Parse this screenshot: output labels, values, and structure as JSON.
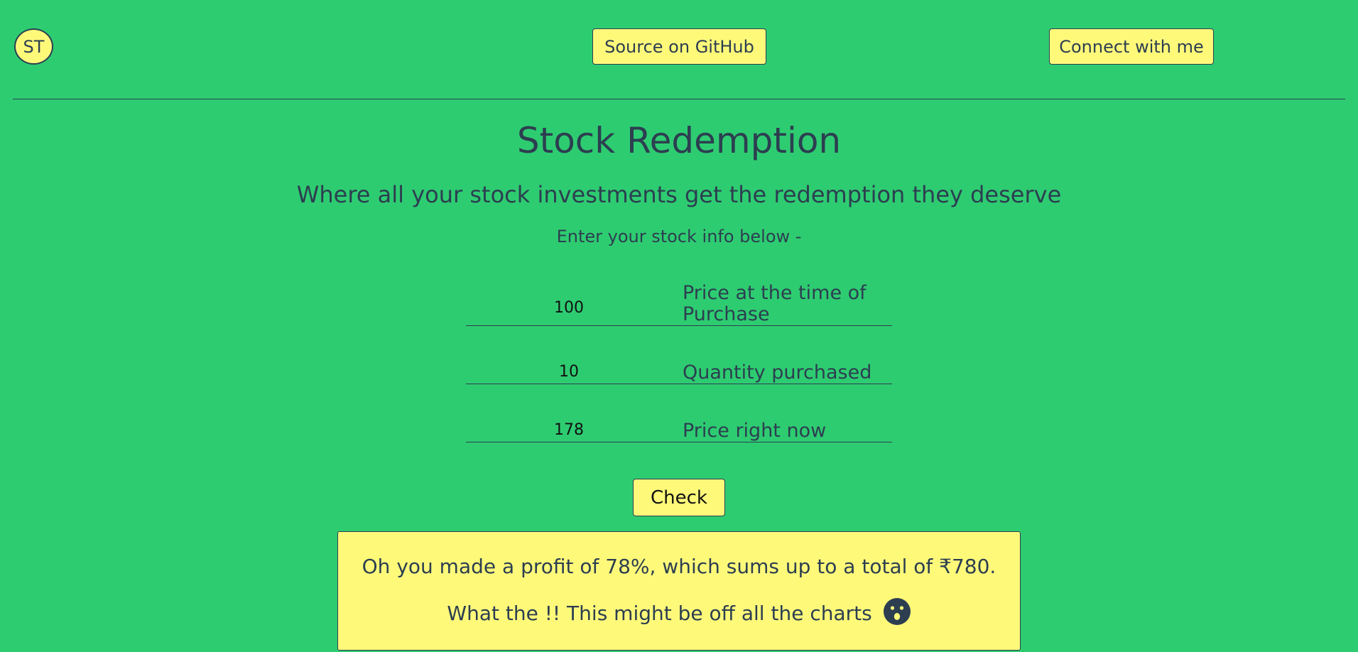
{
  "header": {
    "avatar_initials": "ST",
    "github_label": "Source on GitHub",
    "connect_label": "Connect with me"
  },
  "main": {
    "title": "Stock Redemption",
    "subtitle": "Where all your stock investments get the redemption they deserve",
    "prompt": "Enter your stock info below -"
  },
  "form": {
    "purchase_price": {
      "value": "100",
      "label": "Price at the time of Purchase"
    },
    "quantity": {
      "value": "10",
      "label": "Quantity purchased"
    },
    "current_price": {
      "value": "178",
      "label": "Price right now"
    },
    "check_label": "Check"
  },
  "output": {
    "message": "Oh you made a profit of 78%, which sums up to a total of ₹780.",
    "remark": "What the !! This might be off all the charts",
    "emoji_icon": "astonished-face-icon"
  },
  "colors": {
    "background": "#2ecc71",
    "accent": "#fff97a",
    "text": "#2c3e50"
  }
}
